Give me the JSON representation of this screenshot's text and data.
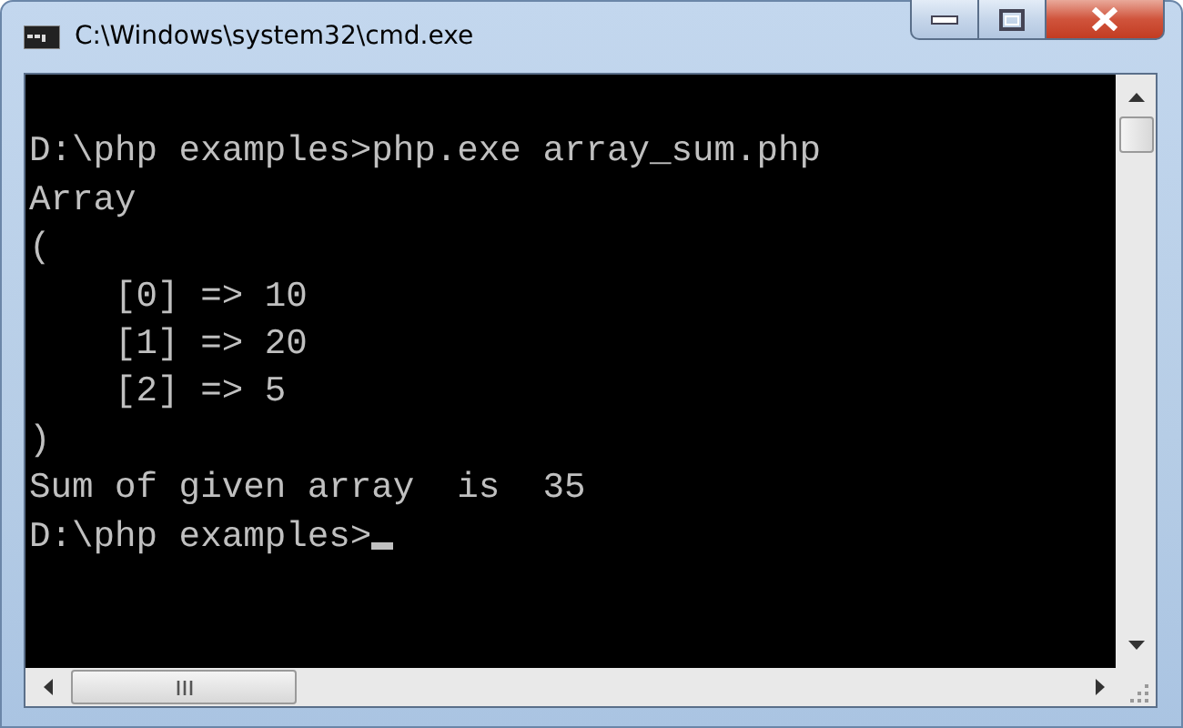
{
  "window": {
    "title": "C:\\Windows\\system32\\cmd.exe"
  },
  "console": {
    "lines": [
      "D:\\php examples>php.exe array_sum.php",
      "Array",
      "(",
      "    [0] => 10",
      "    [1] => 20",
      "    [2] => 5",
      ")",
      "Sum of given array  is  35",
      "D:\\php examples>"
    ]
  }
}
